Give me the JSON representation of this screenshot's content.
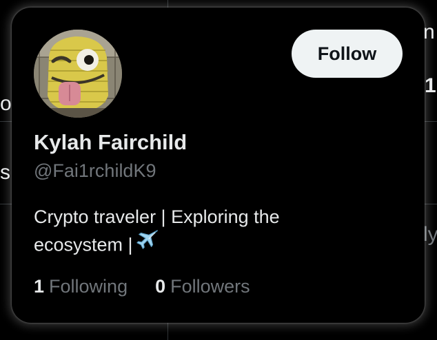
{
  "background": {
    "fragments": [
      {
        "text": "n"
      },
      {
        "text": "1"
      },
      {
        "text": "o"
      },
      {
        "text": "s"
      },
      {
        "text": "ly"
      }
    ]
  },
  "card": {
    "avatar": {
      "icon": "winking-tongue-face-avatar"
    },
    "follow_label": "Follow",
    "display_name": "Kylah Fairchild",
    "handle": "@Fai1rchildK9",
    "bio_line1": "Crypto traveler | Exploring the",
    "bio_line2": "ecosystem |",
    "bio_emoji": "airplane-icon",
    "following_count": "1",
    "following_label": "Following",
    "followers_count": "0",
    "followers_label": "Followers"
  },
  "colors": {
    "background": "#000000",
    "text_primary": "#e7e9ea",
    "text_secondary": "#71767b",
    "button_bg": "#eff3f4",
    "button_text": "#0f1419",
    "divider": "#2f3336"
  }
}
